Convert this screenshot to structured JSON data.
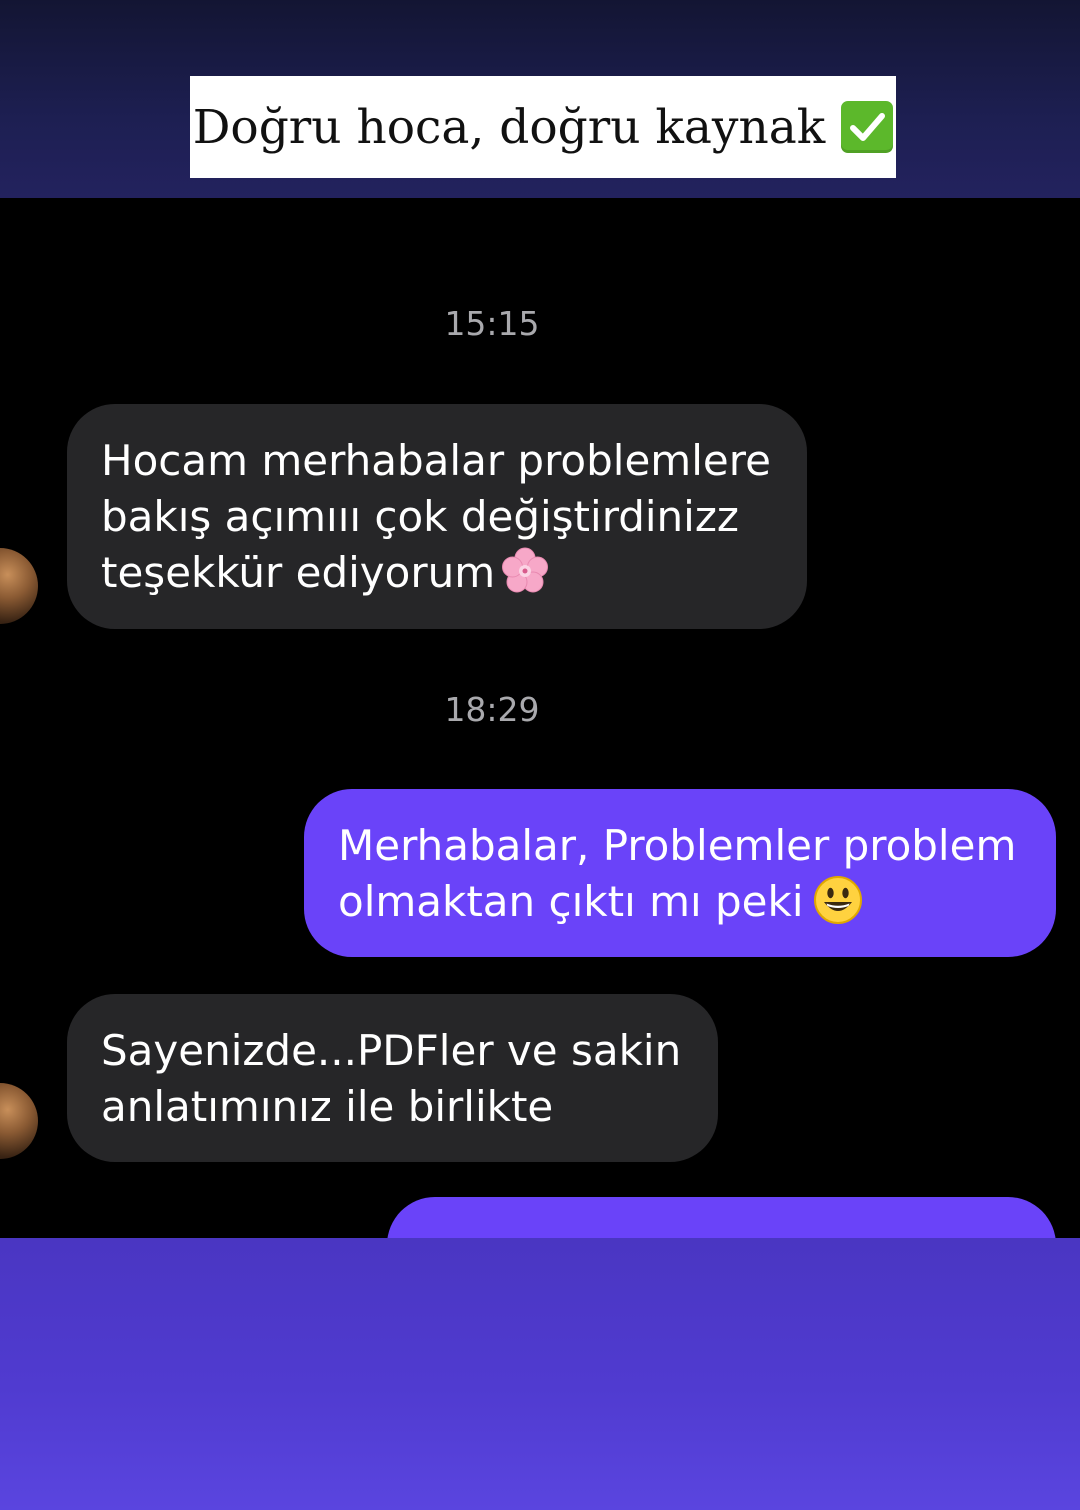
{
  "caption": {
    "text": "Doğru hoca, doğru kaynak",
    "icon": "check-mark-button-icon",
    "icon_color": "#5cb82b"
  },
  "colors": {
    "incoming_bubble": "#262628",
    "outgoing_bubble": "#6a43f9",
    "timestamp_text": "#a9a9ad"
  },
  "messages": [
    {
      "type": "timestamp",
      "text": "15:15"
    },
    {
      "type": "incoming",
      "lines": [
        "Hocam merhabalar problemlere",
        "bakış açımııı çok değiştirdinizz",
        "teşekkür ediyorum"
      ],
      "emoji": "cherry-blossom-icon"
    },
    {
      "type": "timestamp",
      "text": "18:29"
    },
    {
      "type": "outgoing",
      "lines": [
        "Merhabalar, Problemler problem",
        "olmaktan çıktı mı peki"
      ],
      "emoji": "grinning-face-icon"
    },
    {
      "type": "incoming",
      "lines": [
        "Sayenizde...PDFler ve sakin",
        "anlatımınız ile birlikte"
      ]
    }
  ]
}
